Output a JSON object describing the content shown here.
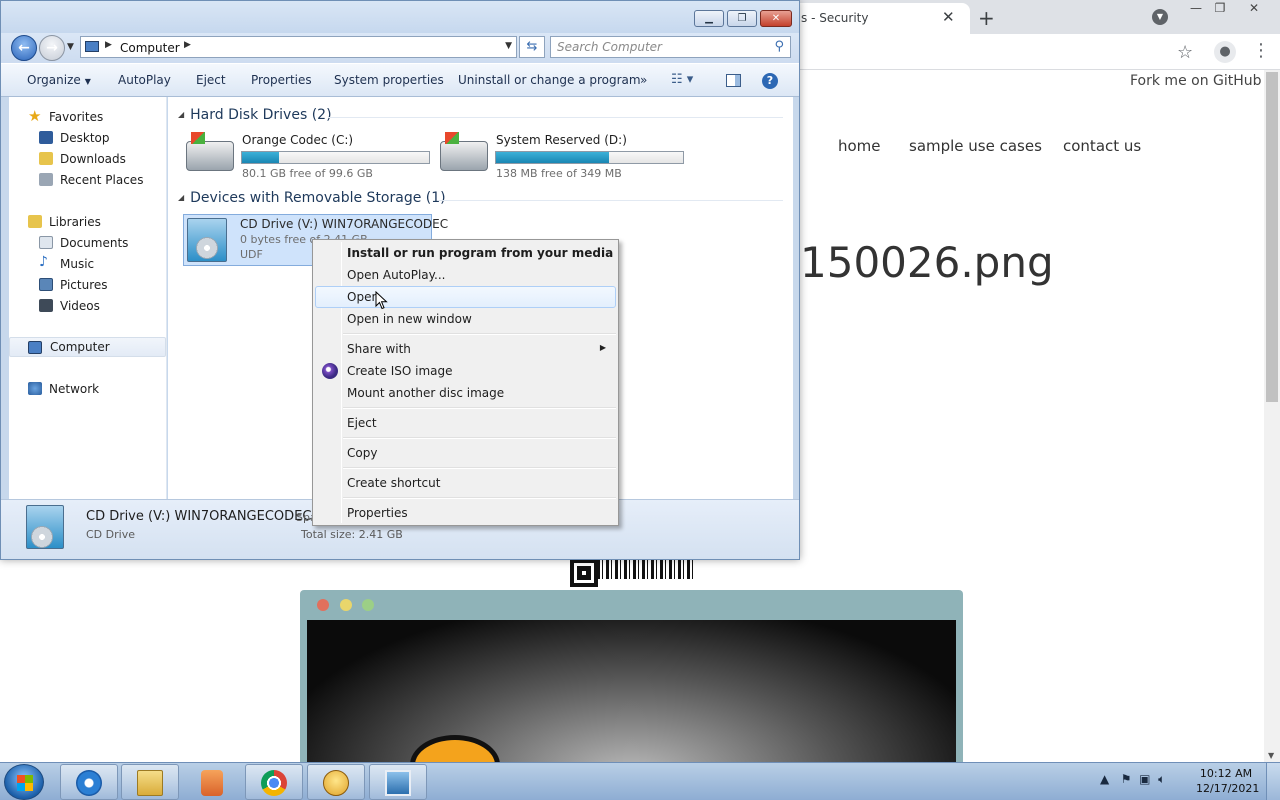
{
  "browser": {
    "tab_title": "s - Security",
    "fork_text": "Fork me on GitHub",
    "nav": [
      "home",
      "sample use cases",
      "contact us"
    ],
    "heading": "150026.png"
  },
  "explorer": {
    "address": {
      "location": "Computer",
      "search_placeholder": "Search Computer"
    },
    "commands": {
      "organize": "Organize",
      "autoplay": "AutoPlay",
      "eject": "Eject",
      "properties": "Properties",
      "system_properties": "System properties",
      "uninstall": "Uninstall or change a program",
      "more": "»"
    },
    "nav_pane": {
      "favorites": "Favorites",
      "desktop": "Desktop",
      "downloads": "Downloads",
      "recent_places": "Recent Places",
      "libraries": "Libraries",
      "documents": "Documents",
      "music": "Music",
      "pictures": "Pictures",
      "videos": "Videos",
      "computer": "Computer",
      "network": "Network"
    },
    "groups": {
      "hard_disks": "Hard Disk Drives (2)",
      "removable": "Devices with Removable Storage (1)"
    },
    "drives": [
      {
        "name": "Orange Codec (C:)",
        "free": "80.1 GB free of 99.6 GB",
        "used_fraction": 0.196
      },
      {
        "name": "System Reserved (D:)",
        "free": "138 MB free of 349 MB",
        "used_fraction": 0.605
      }
    ],
    "cd_drive": {
      "name": "CD Drive (V:) WIN7ORANGECODEC",
      "free": "0 bytes free of 2.41 GB",
      "fs": "UDF"
    },
    "details": {
      "title": "CD Drive (V:) WIN7ORANGECODEC",
      "type": "CD Drive",
      "space_label": "Spa",
      "total": "Total size: 2.41 GB"
    }
  },
  "context_menu": {
    "install": "Install or run program from your media",
    "autoplay": "Open AutoPlay...",
    "open": "Open",
    "open_new": "Open in new window",
    "share": "Share with",
    "create_iso": "Create ISO image",
    "mount": "Mount another disc image",
    "eject": "Eject",
    "copy": "Copy",
    "shortcut": "Create shortcut",
    "properties": "Properties"
  },
  "taskbar": {
    "time": "10:12 AM",
    "date": "12/17/2021"
  }
}
